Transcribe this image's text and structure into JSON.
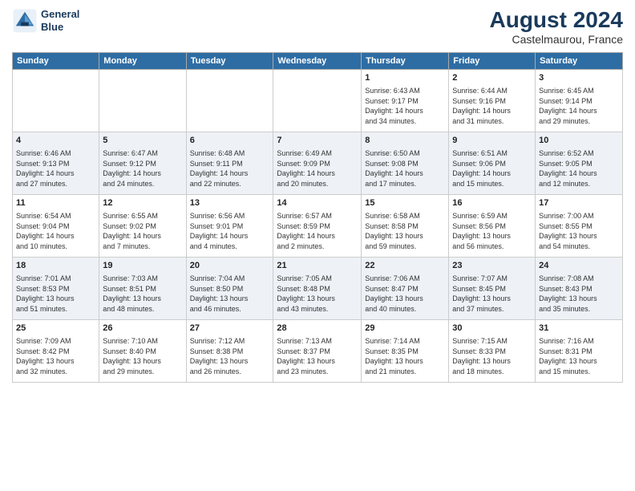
{
  "logo": {
    "line1": "General",
    "line2": "Blue"
  },
  "title": "August 2024",
  "location": "Castelmaurou, France",
  "days_of_week": [
    "Sunday",
    "Monday",
    "Tuesday",
    "Wednesday",
    "Thursday",
    "Friday",
    "Saturday"
  ],
  "weeks": [
    [
      {
        "day": "",
        "info": ""
      },
      {
        "day": "",
        "info": ""
      },
      {
        "day": "",
        "info": ""
      },
      {
        "day": "",
        "info": ""
      },
      {
        "day": "1",
        "info": "Sunrise: 6:43 AM\nSunset: 9:17 PM\nDaylight: 14 hours\nand 34 minutes."
      },
      {
        "day": "2",
        "info": "Sunrise: 6:44 AM\nSunset: 9:16 PM\nDaylight: 14 hours\nand 31 minutes."
      },
      {
        "day": "3",
        "info": "Sunrise: 6:45 AM\nSunset: 9:14 PM\nDaylight: 14 hours\nand 29 minutes."
      }
    ],
    [
      {
        "day": "4",
        "info": "Sunrise: 6:46 AM\nSunset: 9:13 PM\nDaylight: 14 hours\nand 27 minutes."
      },
      {
        "day": "5",
        "info": "Sunrise: 6:47 AM\nSunset: 9:12 PM\nDaylight: 14 hours\nand 24 minutes."
      },
      {
        "day": "6",
        "info": "Sunrise: 6:48 AM\nSunset: 9:11 PM\nDaylight: 14 hours\nand 22 minutes."
      },
      {
        "day": "7",
        "info": "Sunrise: 6:49 AM\nSunset: 9:09 PM\nDaylight: 14 hours\nand 20 minutes."
      },
      {
        "day": "8",
        "info": "Sunrise: 6:50 AM\nSunset: 9:08 PM\nDaylight: 14 hours\nand 17 minutes."
      },
      {
        "day": "9",
        "info": "Sunrise: 6:51 AM\nSunset: 9:06 PM\nDaylight: 14 hours\nand 15 minutes."
      },
      {
        "day": "10",
        "info": "Sunrise: 6:52 AM\nSunset: 9:05 PM\nDaylight: 14 hours\nand 12 minutes."
      }
    ],
    [
      {
        "day": "11",
        "info": "Sunrise: 6:54 AM\nSunset: 9:04 PM\nDaylight: 14 hours\nand 10 minutes."
      },
      {
        "day": "12",
        "info": "Sunrise: 6:55 AM\nSunset: 9:02 PM\nDaylight: 14 hours\nand 7 minutes."
      },
      {
        "day": "13",
        "info": "Sunrise: 6:56 AM\nSunset: 9:01 PM\nDaylight: 14 hours\nand 4 minutes."
      },
      {
        "day": "14",
        "info": "Sunrise: 6:57 AM\nSunset: 8:59 PM\nDaylight: 14 hours\nand 2 minutes."
      },
      {
        "day": "15",
        "info": "Sunrise: 6:58 AM\nSunset: 8:58 PM\nDaylight: 13 hours\nand 59 minutes."
      },
      {
        "day": "16",
        "info": "Sunrise: 6:59 AM\nSunset: 8:56 PM\nDaylight: 13 hours\nand 56 minutes."
      },
      {
        "day": "17",
        "info": "Sunrise: 7:00 AM\nSunset: 8:55 PM\nDaylight: 13 hours\nand 54 minutes."
      }
    ],
    [
      {
        "day": "18",
        "info": "Sunrise: 7:01 AM\nSunset: 8:53 PM\nDaylight: 13 hours\nand 51 minutes."
      },
      {
        "day": "19",
        "info": "Sunrise: 7:03 AM\nSunset: 8:51 PM\nDaylight: 13 hours\nand 48 minutes."
      },
      {
        "day": "20",
        "info": "Sunrise: 7:04 AM\nSunset: 8:50 PM\nDaylight: 13 hours\nand 46 minutes."
      },
      {
        "day": "21",
        "info": "Sunrise: 7:05 AM\nSunset: 8:48 PM\nDaylight: 13 hours\nand 43 minutes."
      },
      {
        "day": "22",
        "info": "Sunrise: 7:06 AM\nSunset: 8:47 PM\nDaylight: 13 hours\nand 40 minutes."
      },
      {
        "day": "23",
        "info": "Sunrise: 7:07 AM\nSunset: 8:45 PM\nDaylight: 13 hours\nand 37 minutes."
      },
      {
        "day": "24",
        "info": "Sunrise: 7:08 AM\nSunset: 8:43 PM\nDaylight: 13 hours\nand 35 minutes."
      }
    ],
    [
      {
        "day": "25",
        "info": "Sunrise: 7:09 AM\nSunset: 8:42 PM\nDaylight: 13 hours\nand 32 minutes."
      },
      {
        "day": "26",
        "info": "Sunrise: 7:10 AM\nSunset: 8:40 PM\nDaylight: 13 hours\nand 29 minutes."
      },
      {
        "day": "27",
        "info": "Sunrise: 7:12 AM\nSunset: 8:38 PM\nDaylight: 13 hours\nand 26 minutes."
      },
      {
        "day": "28",
        "info": "Sunrise: 7:13 AM\nSunset: 8:37 PM\nDaylight: 13 hours\nand 23 minutes."
      },
      {
        "day": "29",
        "info": "Sunrise: 7:14 AM\nSunset: 8:35 PM\nDaylight: 13 hours\nand 21 minutes."
      },
      {
        "day": "30",
        "info": "Sunrise: 7:15 AM\nSunset: 8:33 PM\nDaylight: 13 hours\nand 18 minutes."
      },
      {
        "day": "31",
        "info": "Sunrise: 7:16 AM\nSunset: 8:31 PM\nDaylight: 13 hours\nand 15 minutes."
      }
    ]
  ]
}
